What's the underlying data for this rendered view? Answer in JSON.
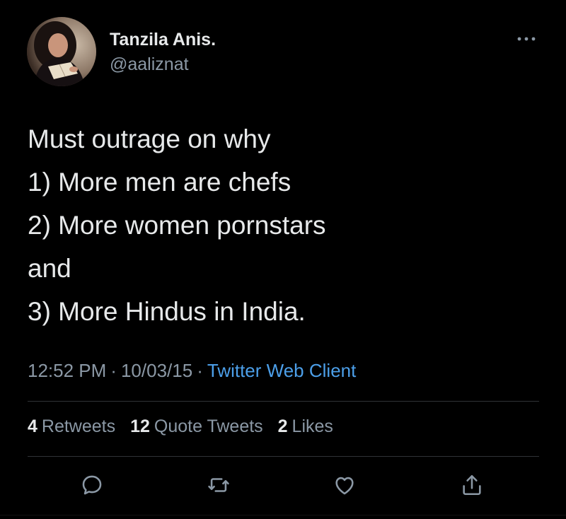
{
  "tweet": {
    "author_name": "Tanzila Anis.",
    "author_handle": "@aaliznat",
    "text_lines": [
      "Must outrage on why",
      "1) More men are chefs",
      "2) More women pornstars",
      "and",
      "3) More Hindus in India."
    ],
    "time": "12:52 PM",
    "date": "10/03/15",
    "separator": "·",
    "source": "Twitter Web Client"
  },
  "stats": {
    "retweets_count": "4",
    "retweets_label": "Retweets",
    "quote_tweets_count": "12",
    "quote_tweets_label": "Quote Tweets",
    "likes_count": "2",
    "likes_label": "Likes"
  },
  "icons": {
    "avatar": "avatar",
    "more": "more-horizontal-icon",
    "reply": "reply-icon",
    "retweet": "retweet-icon",
    "like": "heart-icon",
    "share": "share-icon"
  },
  "colors": {
    "background": "#000000",
    "text_primary": "#e7e9ea",
    "text_secondary": "#8b98a5",
    "link": "#4c9fe9",
    "divider": "#2f3336"
  }
}
